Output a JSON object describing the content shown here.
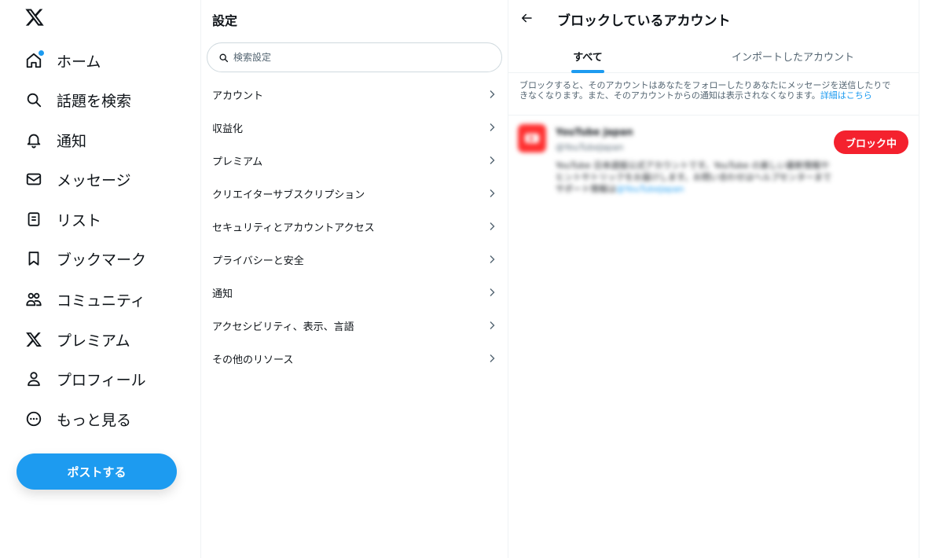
{
  "nav": {
    "logo_icon": "x-logo-icon",
    "items": [
      {
        "label": "ホーム",
        "icon": "home-icon"
      },
      {
        "label": "話題を検索",
        "icon": "search-icon"
      },
      {
        "label": "通知",
        "icon": "bell-icon"
      },
      {
        "label": "メッセージ",
        "icon": "envelope-icon"
      },
      {
        "label": "リスト",
        "icon": "list-icon"
      },
      {
        "label": "ブックマーク",
        "icon": "bookmark-icon"
      },
      {
        "label": "コミュニティ",
        "icon": "community-icon"
      },
      {
        "label": "プレミアム",
        "icon": "x-logo-icon"
      },
      {
        "label": "プロフィール",
        "icon": "person-icon"
      },
      {
        "label": "もっと見る",
        "icon": "more-icon"
      }
    ],
    "post_button": "ポストする"
  },
  "settings": {
    "title": "設定",
    "search_placeholder": "検索設定",
    "items": [
      {
        "label": "アカウント"
      },
      {
        "label": "収益化"
      },
      {
        "label": "プレミアム"
      },
      {
        "label": "クリエイターサブスクリプション"
      },
      {
        "label": "セキュリティとアカウントアクセス"
      },
      {
        "label": "プライバシーと安全"
      },
      {
        "label": "通知"
      },
      {
        "label": "アクセシビリティ、表示、言語"
      },
      {
        "label": "その他のリソース"
      }
    ]
  },
  "blocked": {
    "title": "ブロックしているアカウント",
    "tabs": [
      {
        "label": "すべて"
      },
      {
        "label": "インポートしたアカウント"
      }
    ],
    "description_line1": "ブロックすると、そのアカウントはあなたをフォローしたりあなたにメッセージを送信したりで",
    "description_line2": "きなくなります。また、そのアカウントからの通知は表示されなくなります。",
    "description_link": "詳細はこちら",
    "account": {
      "name": "YouTube Japan",
      "handle": "@YouTubeJapan",
      "bio_line1": "YouTube 日本語版公式アカウントです。YouTube の楽しい最新情報や",
      "bio_line2": "ヒントやトリックをお届けします。お問い合わせはヘルプセンターまで",
      "bio_line3": "サポート情報は",
      "bio_link": "@YouTubeJapan",
      "button": "ブロック中"
    }
  },
  "colors": {
    "accent": "#1d9bf0",
    "danger": "#f4212e",
    "text": "#0f1419",
    "muted": "#536471"
  }
}
